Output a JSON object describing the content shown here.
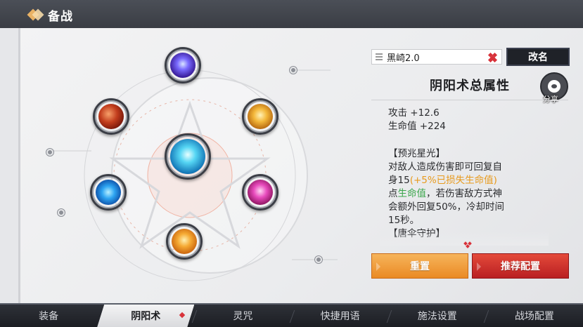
{
  "header": {
    "title": "备战"
  },
  "loadout": {
    "name": "黑崎2.0",
    "rename_label": "改名",
    "share_label": "分享"
  },
  "attributes": {
    "title": "阴阳术总属性",
    "stats": [
      "攻击 +12.6",
      "生命值 +224"
    ]
  },
  "description": {
    "skill1_title": "【预兆星光】",
    "skill1_line1": "对敌人造成伤害即可回复自",
    "skill1_line2a": "身15",
    "skill1_line2b": "(+5%已损失生命值)",
    "skill1_line3a": "点",
    "skill1_line3b": "生命值",
    "skill1_line3c": "，若伤害敌方式神",
    "skill1_line4": "会额外回复50%，冷却时间",
    "skill1_line5": "15秒。",
    "skill2_title": "【唐伞守护】"
  },
  "actions": {
    "reset_label": "重置",
    "recommend_label": "推荐配置"
  },
  "tabs": [
    {
      "label": "装备",
      "active": false
    },
    {
      "label": "阴阳术",
      "active": true
    },
    {
      "label": "灵咒",
      "active": false
    },
    {
      "label": "快捷用语",
      "active": false
    },
    {
      "label": "施法设置",
      "active": false
    },
    {
      "label": "战场配置",
      "active": false
    }
  ],
  "colors": {
    "accent_orange": "#e89a1c",
    "accent_green": "#3aa54a",
    "accent_red": "#d8323a"
  },
  "spells": [
    {
      "icon": "purple-barrier-spell-icon"
    },
    {
      "icon": "red-flame-spell-icon"
    },
    {
      "icon": "gold-swirl-spell-icon"
    },
    {
      "icon": "blue-star-spell-icon"
    },
    {
      "icon": "blue-lightning-spell-icon"
    },
    {
      "icon": "pink-dancer-spell-icon"
    },
    {
      "icon": "orange-leaf-spell-icon"
    }
  ]
}
